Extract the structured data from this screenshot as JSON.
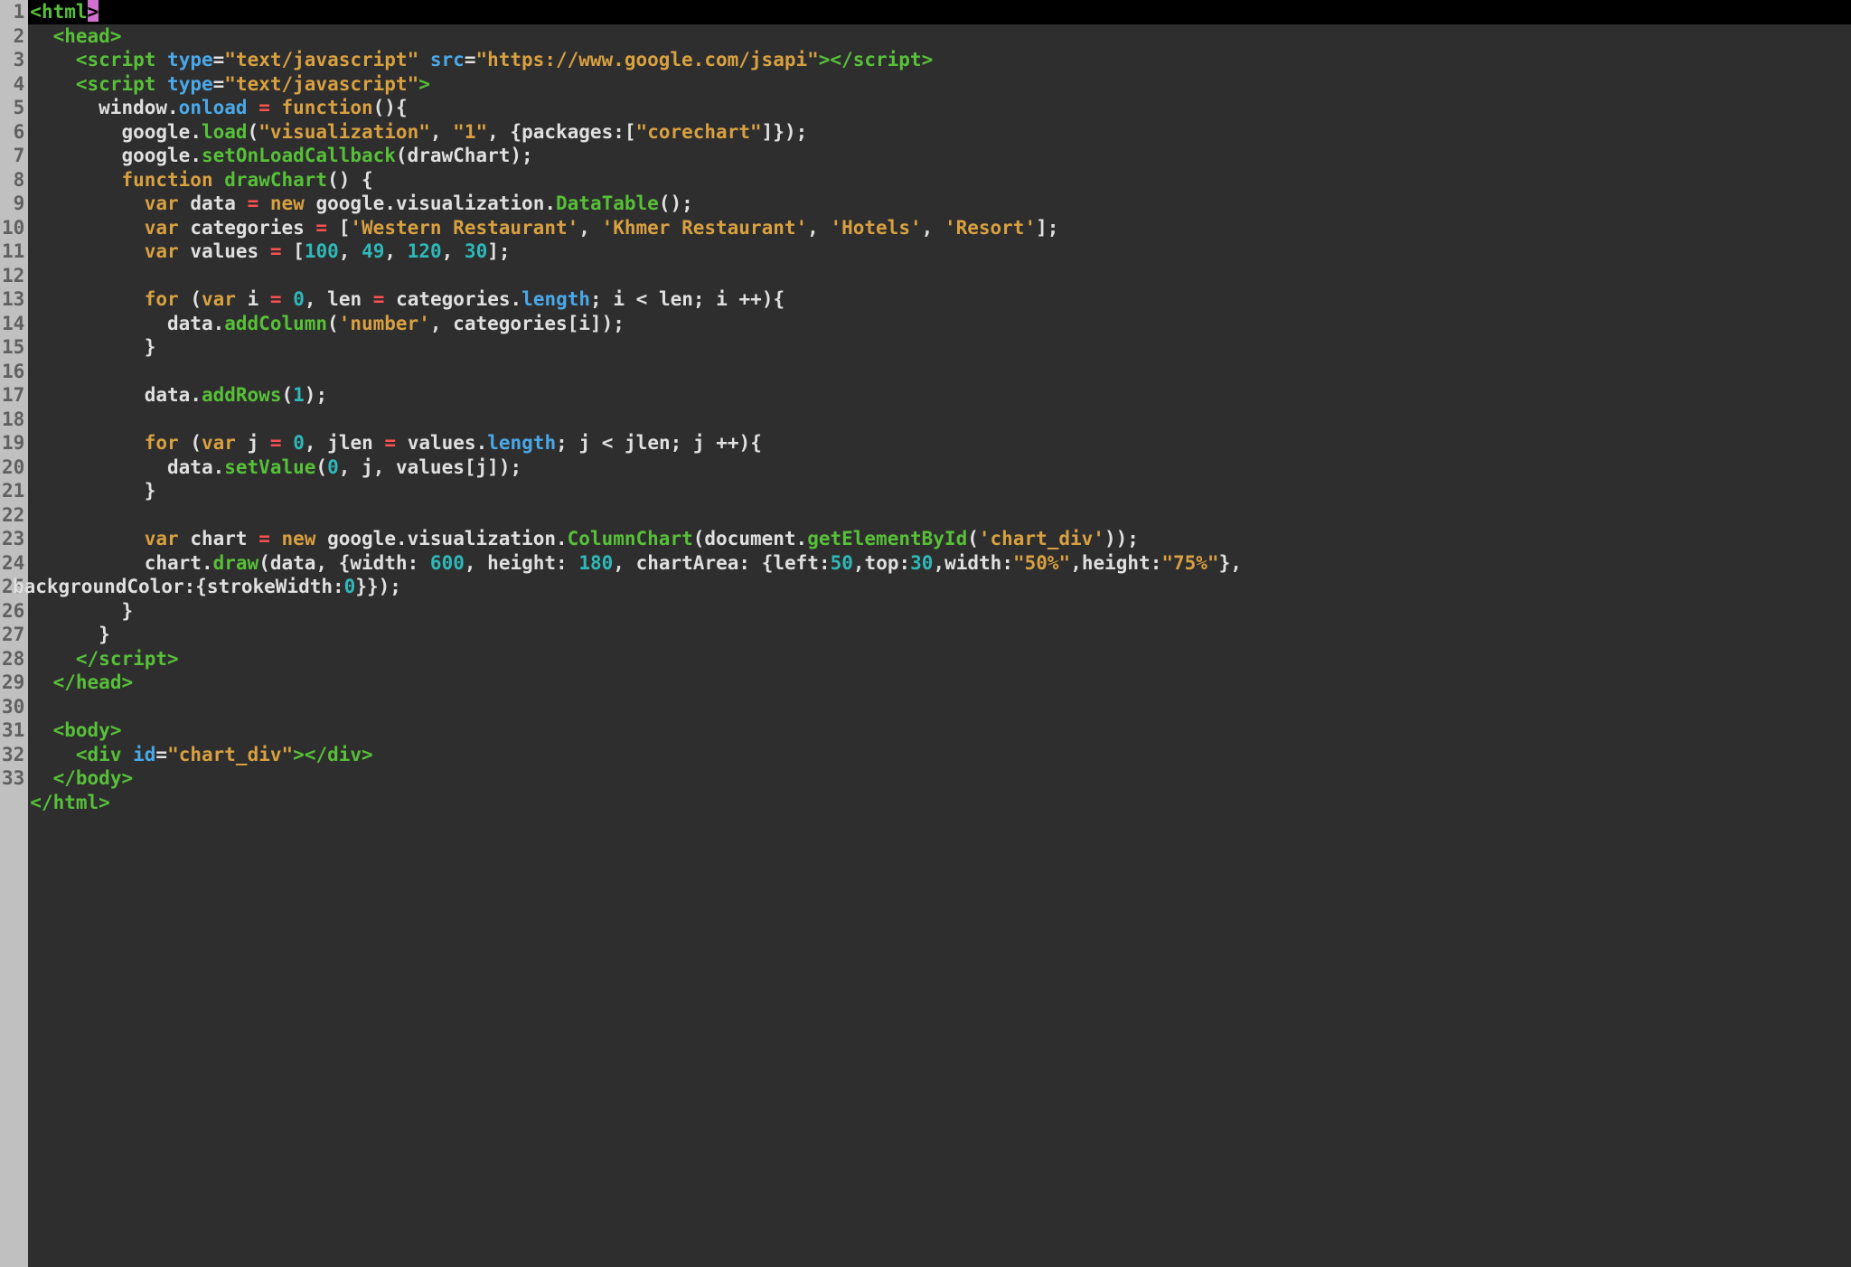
{
  "gutter": {
    "lines": [
      "1",
      "2",
      "3",
      "4",
      "5",
      "6",
      "7",
      "8",
      "9",
      "10",
      "11",
      "12",
      "13",
      "14",
      "15",
      "16",
      "17",
      "18",
      "19",
      "20",
      "21",
      "22",
      "23",
      "24",
      "25",
      "26",
      "27",
      "28",
      "29",
      "30",
      "31",
      "32",
      "33"
    ]
  },
  "code": {
    "l1": {
      "open": "<",
      "tag": "html",
      "close": ">"
    },
    "l2": {
      "indent": "  ",
      "open": "<",
      "tag": "head",
      "close": ">"
    },
    "l3": {
      "indent": "    ",
      "open": "<",
      "tag": "script",
      "sp": " ",
      "attr1": "type",
      "eq": "=",
      "val1": "\"text/javascript\"",
      "sp2": " ",
      "attr2": "src",
      "eq2": "=",
      "val2": "\"https://www.google.com/jsapi\"",
      "close1": ">",
      "open2": "</",
      "tag2": "script",
      "close2": ">"
    },
    "l4": {
      "indent": "    ",
      "open": "<",
      "tag": "script",
      "sp": " ",
      "attr1": "type",
      "eq": "=",
      "val1": "\"text/javascript\"",
      "close": ">"
    },
    "l5": {
      "indent": "      ",
      "t1": "window",
      "dot1": ".",
      "t2": "onload",
      "sp1": " ",
      "op": "=",
      "sp2": " ",
      "kw": "function",
      "paren": "()",
      "brace": "{"
    },
    "l6": {
      "indent": "        ",
      "t1": "google",
      "dot1": ".",
      "fn": "load",
      "p1": "(",
      "s1": "\"visualization\"",
      "c1": ",",
      "sp1": " ",
      "s2": "\"1\"",
      "c2": ",",
      "sp2": " ",
      "b1": "{",
      "k1": "packages",
      "colon": ":",
      "br1": "[",
      "s3": "\"corechart\"",
      "br2": "]",
      "b2": "}",
      "p2": ")",
      "semi": ";"
    },
    "l7": {
      "indent": "        ",
      "t1": "google",
      "dot1": ".",
      "fn": "setOnLoadCallback",
      "p1": "(",
      "arg": "drawChart",
      "p2": ")",
      "semi": ";"
    },
    "l8": {
      "indent": "        ",
      "kw": "function",
      "sp": " ",
      "fn": "drawChart",
      "paren": "()",
      "sp2": " ",
      "brace": "{"
    },
    "l9": {
      "indent": "          ",
      "kw": "var",
      "sp": " ",
      "id": "data",
      "sp2": " ",
      "op": "=",
      "sp3": " ",
      "kw2": "new",
      "sp4": " ",
      "obj": "google",
      "dot": ".",
      "p1": "visualization",
      "dot2": ".",
      "fn": "DataTable",
      "paren": "()",
      "semi": ";"
    },
    "l10": {
      "indent": "          ",
      "kw": "var",
      "sp": " ",
      "id": "categories",
      "sp2": " ",
      "op": "=",
      "sp3": " ",
      "br1": "[",
      "s1": "'Western Restaurant'",
      "c1": ",",
      "sp4": " ",
      "s2": "'Khmer Restaurant'",
      "c2": ",",
      "sp5": " ",
      "s3": "'Hotels'",
      "c3": ",",
      "sp6": " ",
      "s4": "'Resort'",
      "br2": "]",
      "semi": ";"
    },
    "l11": {
      "indent": "          ",
      "kw": "var",
      "sp": " ",
      "id": "values",
      "sp2": " ",
      "op": "=",
      "sp3": " ",
      "br1": "[",
      "n1": "100",
      "c1": ",",
      "sp4": " ",
      "n2": "49",
      "c2": ",",
      "sp5": " ",
      "n3": "120",
      "c3": ",",
      "sp6": " ",
      "n4": "30",
      "br2": "]",
      "semi": ";"
    },
    "l13": {
      "indent": "          ",
      "kw": "for",
      "sp": " ",
      "p1": "(",
      "kw2": "var",
      "sp2": " ",
      "id": "i",
      "sp3": " ",
      "op": "=",
      "sp4": " ",
      "n1": "0",
      "c1": ",",
      "sp5": " ",
      "id2": "len",
      "sp6": " ",
      "op2": "=",
      "sp7": " ",
      "id3": "categories",
      "dot": ".",
      "prop": "length",
      "semi1": ";",
      "sp8": " ",
      "id4": "i",
      "sp9": " ",
      "lt": "<",
      "sp10": " ",
      "id5": "len",
      "semi2": ";",
      "sp11": " ",
      "id6": "i",
      "sp12": " ",
      "inc": "++",
      "p2": ")",
      "brace": "{"
    },
    "l14": {
      "indent": "            ",
      "id": "data",
      "dot": ".",
      "fn": "addColumn",
      "p1": "(",
      "s1": "'number'",
      "c1": ",",
      "sp": " ",
      "id2": "categories",
      "br1": "[",
      "id3": "i",
      "br2": "]",
      "p2": ")",
      "semi": ";"
    },
    "l15": {
      "indent": "          ",
      "brace": "}"
    },
    "l17": {
      "indent": "          ",
      "id": "data",
      "dot": ".",
      "fn": "addRows",
      "p1": "(",
      "n1": "1",
      "p2": ")",
      "semi": ";"
    },
    "l19": {
      "indent": "          ",
      "kw": "for",
      "sp": " ",
      "p1": "(",
      "kw2": "var",
      "sp2": " ",
      "id": "j",
      "sp3": " ",
      "op": "=",
      "sp4": " ",
      "n1": "0",
      "c1": ",",
      "sp5": " ",
      "id2": "jlen",
      "sp6": " ",
      "op2": "=",
      "sp7": " ",
      "id3": "values",
      "dot": ".",
      "prop": "length",
      "semi1": ";",
      "sp8": " ",
      "id4": "j",
      "sp9": " ",
      "lt": "<",
      "sp10": " ",
      "id5": "jlen",
      "semi2": ";",
      "sp11": " ",
      "id6": "j",
      "sp12": " ",
      "inc": "++",
      "p2": ")",
      "brace": "{"
    },
    "l20": {
      "indent": "            ",
      "id": "data",
      "dot": ".",
      "fn": "setValue",
      "p1": "(",
      "n1": "0",
      "c1": ",",
      "sp": " ",
      "id2": "j",
      "c2": ",",
      "sp2": " ",
      "id3": "values",
      "br1": "[",
      "id4": "j",
      "br2": "]",
      "p2": ")",
      "semi": ";"
    },
    "l21": {
      "indent": "          ",
      "brace": "}"
    },
    "l23": {
      "indent": "          ",
      "kw": "var",
      "sp": " ",
      "id": "chart",
      "sp2": " ",
      "op": "=",
      "sp3": " ",
      "kw2": "new",
      "sp4": " ",
      "obj": "google",
      "dot": ".",
      "p1": "visualization",
      "dot2": ".",
      "fn": "ColumnChart",
      "pp1": "(",
      "d": "document",
      "dot3": ".",
      "fn2": "getElementById",
      "pp2": "(",
      "s1": "'chart_div'",
      "pp3": ")",
      "pp4": ")",
      "semi": ";"
    },
    "l24a": {
      "indent": "          ",
      "id": "chart",
      "dot": ".",
      "fn": "draw",
      "p1": "(",
      "id2": "data",
      "c1": ",",
      "sp": " ",
      "b1": "{",
      "k1": "width",
      "colon1": ":",
      "sp2": " ",
      "n1": "600",
      "c2": ",",
      "sp3": " ",
      "k2": "height",
      "colon2": ":",
      "sp4": " ",
      "n2": "180",
      "c3": ",",
      "sp5": " ",
      "k3": "chartArea",
      "colon3": ":",
      "sp6": " ",
      "b2": "{",
      "k4": "left",
      "colon4": ":",
      "n3": "50",
      "c4": ",",
      "k5": "top",
      "colon5": ":",
      "n4": "30",
      "c5": ",",
      "k6": "width",
      "colon6": ":",
      "s1": "\"50%\"",
      "c6": ",",
      "k7": "height",
      "colon7": ":",
      "s2": "\"75%\"",
      "b3": "}",
      "c7": ","
    },
    "l24b": {
      "indent": " ",
      "k1": "backgroundColor",
      "colon": ":",
      "b1": "{",
      "k2": "strokeWidth",
      "colon2": ":",
      "n1": "0",
      "b2": "}",
      "b3": "}",
      "p2": ")",
      "semi": ";"
    },
    "l25": {
      "indent": "        ",
      "brace": "}"
    },
    "l26": {
      "indent": "      ",
      "brace": "}"
    },
    "l27": {
      "indent": "    ",
      "open": "</",
      "tag": "script",
      "close": ">"
    },
    "l28": {
      "indent": "  ",
      "open": "</",
      "tag": "head",
      "close": ">"
    },
    "l30": {
      "indent": "  ",
      "open": "<",
      "tag": "body",
      "close": ">"
    },
    "l31": {
      "indent": "    ",
      "open": "<",
      "tag": "div",
      "sp": " ",
      "attr": "id",
      "eq": "=",
      "val": "\"chart_div\"",
      "close1": ">",
      "open2": "</",
      "tag2": "div",
      "close2": ">"
    },
    "l32": {
      "indent": "  ",
      "open": "</",
      "tag": "body",
      "close": ">"
    },
    "l33": {
      "open": "</",
      "tag": "html",
      "close": ">"
    }
  }
}
